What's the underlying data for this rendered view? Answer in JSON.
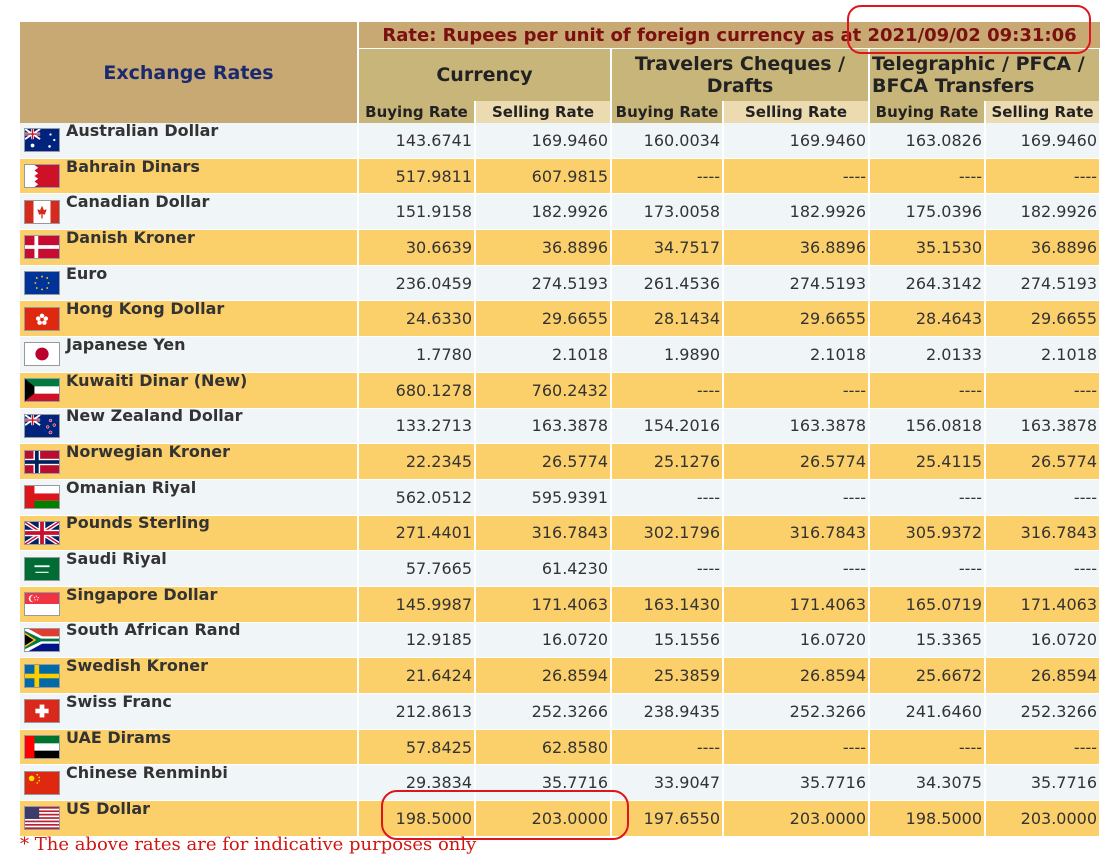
{
  "header": {
    "title": "Exchange Rates",
    "rate_prefix": "Rate: Rupees per unit of foreign currency as at ",
    "rate_timestamp": "2021/09/02  09:31:06",
    "groups": [
      "Currency",
      "Travelers Cheques / Drafts",
      "Telegraphic / PFCA / BFCA Transfers"
    ],
    "buying": "Buying Rate",
    "selling": "Selling Rate"
  },
  "rows": [
    {
      "name": "Australian Dollar",
      "flag": "australia-flag-icon",
      "c_buy": "143.6741",
      "c_sell": "169.9460",
      "tc_buy": "160.0034",
      "tc_sell": "169.9460",
      "tt_buy": "163.0826",
      "tt_sell": "169.9460"
    },
    {
      "name": "Bahrain Dinars",
      "flag": "bahrain-flag-icon",
      "c_buy": "517.9811",
      "c_sell": "607.9815",
      "tc_buy": "----",
      "tc_sell": "----",
      "tt_buy": "----",
      "tt_sell": "----"
    },
    {
      "name": "Canadian Dollar",
      "flag": "canada-flag-icon",
      "c_buy": "151.9158",
      "c_sell": "182.9926",
      "tc_buy": "173.0058",
      "tc_sell": "182.9926",
      "tt_buy": "175.0396",
      "tt_sell": "182.9926"
    },
    {
      "name": "Danish Kroner",
      "flag": "denmark-flag-icon",
      "c_buy": "30.6639",
      "c_sell": "36.8896",
      "tc_buy": "34.7517",
      "tc_sell": "36.8896",
      "tt_buy": "35.1530",
      "tt_sell": "36.8896"
    },
    {
      "name": "Euro",
      "flag": "eu-flag-icon",
      "c_buy": "236.0459",
      "c_sell": "274.5193",
      "tc_buy": "261.4536",
      "tc_sell": "274.5193",
      "tt_buy": "264.3142",
      "tt_sell": "274.5193"
    },
    {
      "name": "Hong Kong Dollar",
      "flag": "hong-kong-flag-icon",
      "c_buy": "24.6330",
      "c_sell": "29.6655",
      "tc_buy": "28.1434",
      "tc_sell": "29.6655",
      "tt_buy": "28.4643",
      "tt_sell": "29.6655"
    },
    {
      "name": "Japanese Yen",
      "flag": "japan-flag-icon",
      "c_buy": "1.7780",
      "c_sell": "2.1018",
      "tc_buy": "1.9890",
      "tc_sell": "2.1018",
      "tt_buy": "2.0133",
      "tt_sell": "2.1018"
    },
    {
      "name": "Kuwaiti Dinar (New)",
      "flag": "kuwait-flag-icon",
      "c_buy": "680.1278",
      "c_sell": "760.2432",
      "tc_buy": "----",
      "tc_sell": "----",
      "tt_buy": "----",
      "tt_sell": "----"
    },
    {
      "name": "New Zealand Dollar",
      "flag": "new-zealand-flag-icon",
      "c_buy": "133.2713",
      "c_sell": "163.3878",
      "tc_buy": "154.2016",
      "tc_sell": "163.3878",
      "tt_buy": "156.0818",
      "tt_sell": "163.3878"
    },
    {
      "name": "Norwegian Kroner",
      "flag": "norway-flag-icon",
      "c_buy": "22.2345",
      "c_sell": "26.5774",
      "tc_buy": "25.1276",
      "tc_sell": "26.5774",
      "tt_buy": "25.4115",
      "tt_sell": "26.5774"
    },
    {
      "name": "Omanian Riyal",
      "flag": "oman-flag-icon",
      "c_buy": "562.0512",
      "c_sell": "595.9391",
      "tc_buy": "----",
      "tc_sell": "----",
      "tt_buy": "----",
      "tt_sell": "----"
    },
    {
      "name": "Pounds Sterling",
      "flag": "uk-flag-icon",
      "c_buy": "271.4401",
      "c_sell": "316.7843",
      "tc_buy": "302.1796",
      "tc_sell": "316.7843",
      "tt_buy": "305.9372",
      "tt_sell": "316.7843"
    },
    {
      "name": "Saudi Riyal",
      "flag": "saudi-arabia-flag-icon",
      "c_buy": "57.7665",
      "c_sell": "61.4230",
      "tc_buy": "----",
      "tc_sell": "----",
      "tt_buy": "----",
      "tt_sell": "----"
    },
    {
      "name": "Singapore Dollar",
      "flag": "singapore-flag-icon",
      "c_buy": "145.9987",
      "c_sell": "171.4063",
      "tc_buy": "163.1430",
      "tc_sell": "171.4063",
      "tt_buy": "165.0719",
      "tt_sell": "171.4063"
    },
    {
      "name": "South African Rand",
      "flag": "south-africa-flag-icon",
      "c_buy": "12.9185",
      "c_sell": "16.0720",
      "tc_buy": "15.1556",
      "tc_sell": "16.0720",
      "tt_buy": "15.3365",
      "tt_sell": "16.0720"
    },
    {
      "name": "Swedish Kroner",
      "flag": "sweden-flag-icon",
      "c_buy": "21.6424",
      "c_sell": "26.8594",
      "tc_buy": "25.3859",
      "tc_sell": "26.8594",
      "tt_buy": "25.6672",
      "tt_sell": "26.8594"
    },
    {
      "name": "Swiss Franc",
      "flag": "switzerland-flag-icon",
      "c_buy": "212.8613",
      "c_sell": "252.3266",
      "tc_buy": "238.9435",
      "tc_sell": "252.3266",
      "tt_buy": "241.6460",
      "tt_sell": "252.3266"
    },
    {
      "name": "UAE Dirams",
      "flag": "uae-flag-icon",
      "c_buy": "57.8425",
      "c_sell": "62.8580",
      "tc_buy": "----",
      "tc_sell": "----",
      "tt_buy": "----",
      "tt_sell": "----"
    },
    {
      "name": "Chinese Renminbi",
      "flag": "china-flag-icon",
      "c_buy": "29.3834",
      "c_sell": "35.7716",
      "tc_buy": "33.9047",
      "tc_sell": "35.7716",
      "tt_buy": "34.3075",
      "tt_sell": "35.7716"
    },
    {
      "name": "US Dollar",
      "flag": "usa-flag-icon",
      "c_buy": "198.5000",
      "c_sell": "203.0000",
      "tc_buy": "197.6550",
      "tc_sell": "203.0000",
      "tt_buy": "198.5000",
      "tt_sell": "203.0000"
    }
  ],
  "footnote": "* The above rates are for indicative purposes only",
  "colors": {
    "header_tan": "#c8a873",
    "row_gold": "#fbcf6a",
    "row_light": "#f0f5f8",
    "annotation_red": "#e0141c",
    "title_navy": "#1a2a6c"
  }
}
